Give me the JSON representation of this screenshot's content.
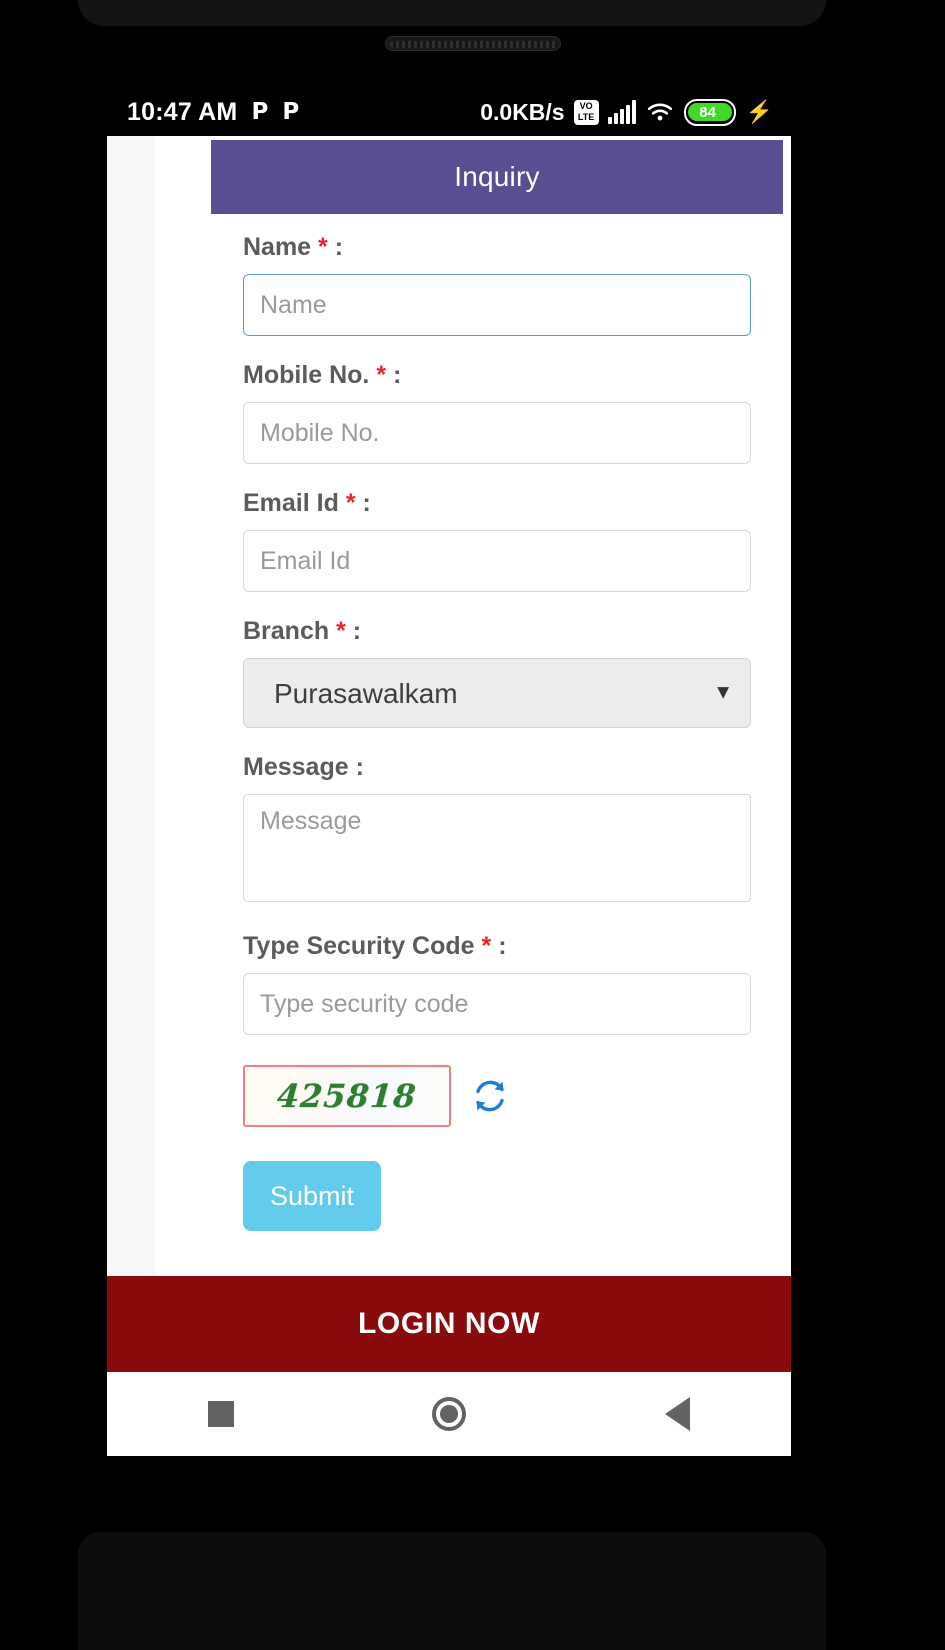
{
  "status_bar": {
    "clock": "10:47 AM",
    "app_icon_1": "P",
    "app_icon_2": "P",
    "network_speed": "0.0KB/s",
    "volte_top": "VO",
    "volte_bottom": "LTE",
    "battery_percent": "84",
    "charging": "⚡"
  },
  "header": {
    "title": "Inquiry",
    "background": "#574f92"
  },
  "form": {
    "name": {
      "label": "Name",
      "required_mark": "*",
      "colon": ":",
      "placeholder": "Name",
      "value": ""
    },
    "mobile": {
      "label": "Mobile No.",
      "required_mark": "*",
      "colon": ":",
      "placeholder": "Mobile No.",
      "value": ""
    },
    "email": {
      "label": "Email Id",
      "required_mark": "*",
      "colon": ":",
      "placeholder": "Email Id",
      "value": ""
    },
    "branch": {
      "label": "Branch",
      "required_mark": "*",
      "colon": ":",
      "selected": "Purasawalkam",
      "options": [
        "Purasawalkam"
      ],
      "arrow": "▼"
    },
    "message": {
      "label": "Message",
      "required_mark": "",
      "colon": ":",
      "placeholder": "Message",
      "value": ""
    },
    "security_code": {
      "label": "Type Security Code",
      "required_mark": "*",
      "colon": ":",
      "placeholder": "Type security code",
      "value": ""
    },
    "captcha": {
      "code": "425818",
      "border_color": "#f08080",
      "text_color": "#2e7d32"
    },
    "submit": {
      "label": "Submit",
      "color": "#62cbeb"
    }
  },
  "login_bar": {
    "label": "LOGIN NOW",
    "background": "#8a0b0b"
  },
  "nav_bar": {
    "recents": "recents",
    "home": "home",
    "back": "back"
  }
}
